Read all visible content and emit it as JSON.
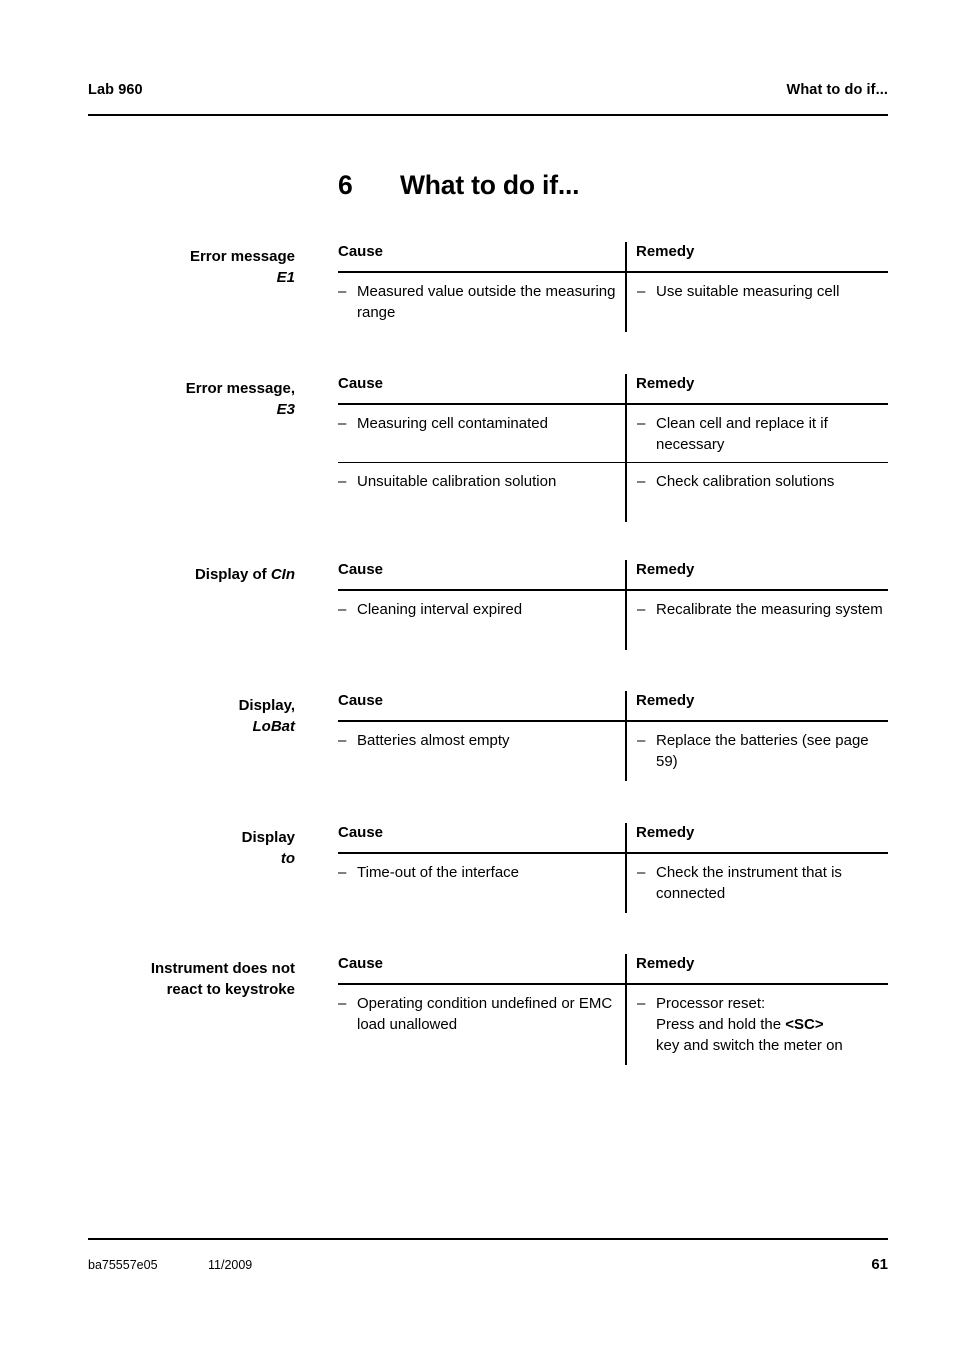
{
  "header": {
    "left": "Lab 960",
    "right": "What to do if..."
  },
  "chapter": {
    "number": "6",
    "title": "What to do if..."
  },
  "table_headers": {
    "cause": "Cause",
    "remedy": "Remedy"
  },
  "bullet": "–",
  "blocks": [
    {
      "label_line1": "Error message",
      "label_line2_italic": "E1",
      "rows": [
        {
          "cause": "Measured value outside the measuring range",
          "remedy": "Use suitable measuring cell"
        }
      ]
    },
    {
      "label_line1": "Error message,",
      "label_line2_italic": "E3",
      "rows": [
        {
          "cause": "Measuring cell contaminated",
          "remedy": "Clean cell and replace it if necessary"
        },
        {
          "cause": "Unsuitable calibration solution",
          "remedy": "Check calibration solutions"
        }
      ]
    },
    {
      "label_line1": "Display of ",
      "label_line2_italic": "CIn",
      "label_inline": true,
      "rows": [
        {
          "cause": "Cleaning interval expired",
          "remedy": "Recalibrate the measuring system"
        }
      ]
    },
    {
      "label_line1": "Display,",
      "label_line2_italic": "LoBat",
      "rows": [
        {
          "cause": "Batteries almost empty",
          "remedy": "Replace the batteries (see page 59)"
        }
      ]
    },
    {
      "label_line1": "Display",
      "label_line2_italic": "to",
      "rows": [
        {
          "cause": "Time-out of the interface",
          "remedy": "Check the instrument that is connected"
        }
      ]
    },
    {
      "label_line1": "Instrument does not",
      "label_line2": "react to keystroke",
      "rows": [
        {
          "cause": "Operating condition undefined or EMC load unallowed",
          "remedy_parts": [
            {
              "text": "Processor reset:",
              "bold": false
            },
            {
              "text": "Press and hold the ",
              "bold": false
            },
            {
              "text": "<SC>",
              "bold": true
            },
            {
              "text": " key and switch the meter on",
              "bold": false
            }
          ]
        }
      ]
    }
  ],
  "footer": {
    "doc_id": "ba75557e05",
    "date": "11/2009",
    "page_number": "61"
  }
}
